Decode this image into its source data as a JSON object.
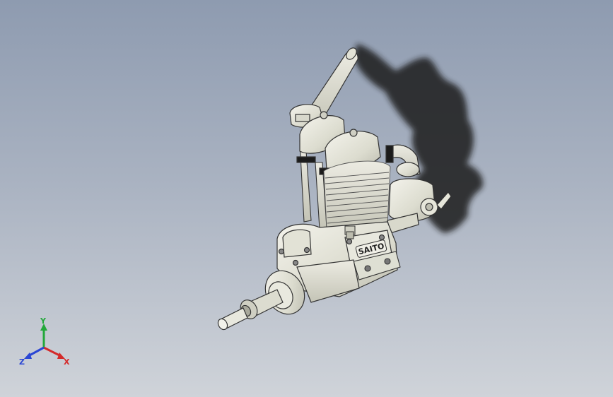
{
  "model": {
    "brand_text": "SAITO"
  },
  "triad": {
    "x_label": "X",
    "y_label": "Y",
    "z_label": "Z",
    "x_color": "#d42a2a",
    "y_color": "#22a83a",
    "z_color": "#2a46d4"
  }
}
